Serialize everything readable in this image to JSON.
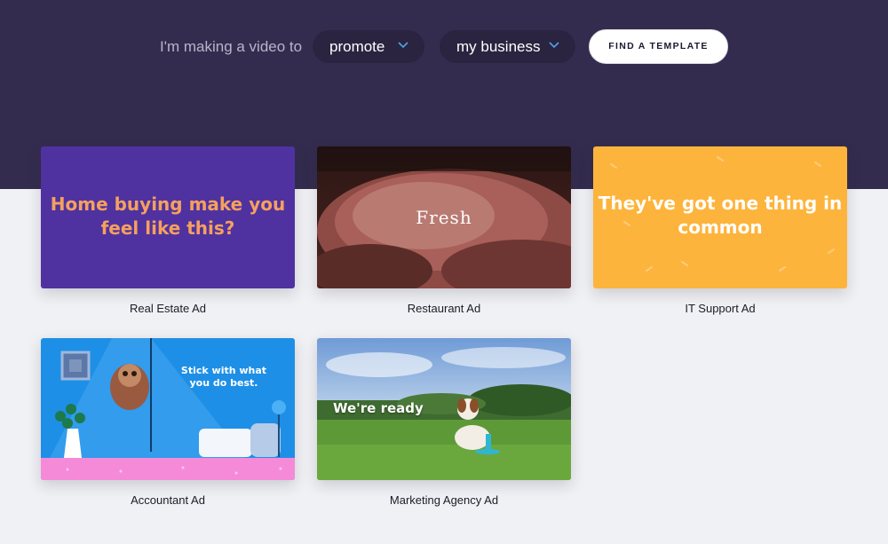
{
  "picker": {
    "lead": "I'm making a video to",
    "purpose": "promote",
    "subject": "my business",
    "button": "FIND A TEMPLATE"
  },
  "templates": [
    {
      "title": "Real Estate Ad",
      "thumb_text": "Home buying make you feel like this?"
    },
    {
      "title": "Restaurant Ad",
      "thumb_text": "Fresh"
    },
    {
      "title": "IT Support Ad",
      "thumb_text": "They've got one thing in common"
    },
    {
      "title": "Accountant Ad",
      "thumb_text": "Stick with what you do best."
    },
    {
      "title": "Marketing Agency Ad",
      "thumb_text": "We're ready"
    }
  ],
  "colors": {
    "hero": "#342c4e",
    "page": "#f0f1f4",
    "accent": "#4fa3e8"
  }
}
